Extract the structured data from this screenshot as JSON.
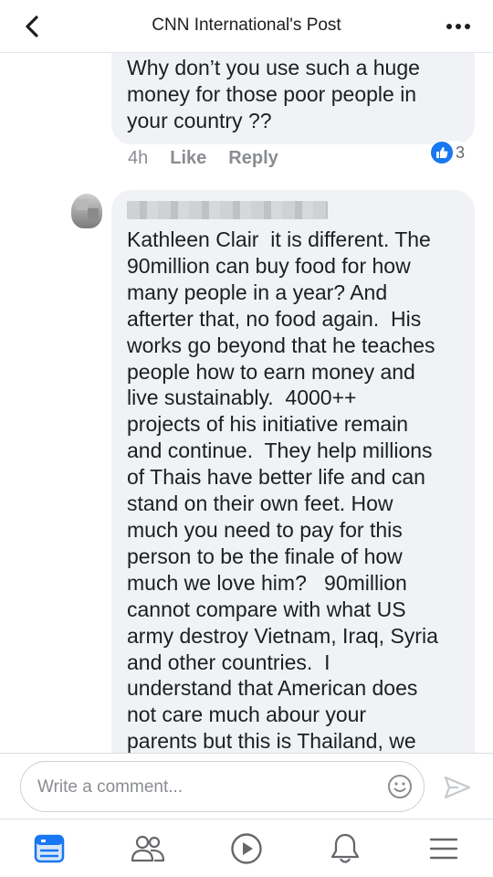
{
  "header": {
    "title": "CNN International's Post"
  },
  "comments": [
    {
      "text": "Why don’t you use such a huge\nmoney for those poor people in\nyour country ??",
      "time": "4h",
      "like_label": "Like",
      "reply_label": "Reply",
      "reaction_count": "3"
    },
    {
      "text": "Kathleen Clair  it is different. The\n90million can buy food for how\nmany people in a year? And\nafterter that, no food again.  His\nworks go beyond that he teaches\npeople how to earn money and\nlive sustainably.  4000++\nprojects of his initiative remain\nand continue.  They help millions\nof Thais have better life and can\nstand on their own feet. How\nmuch you need to pay for this\nperson to be the finale of how\nmuch we love him?   90million\ncannot compare with what US\narmy destroy Vietnam, Iraq, Syria\nand other countries.  I\nunderstand that American does\nnot care much abour your\nparents but this is Thailand, we"
    }
  ],
  "composer": {
    "placeholder": "Write a comment..."
  },
  "colors": {
    "accent": "#1877f2",
    "bubble": "#f0f2f5",
    "meta_text": "#8a8d91"
  },
  "icons": {
    "back": "chevron-left-icon",
    "more": "more-dots-icon",
    "like_reaction": "thumbs-up-icon",
    "emoji": "smiley-icon",
    "send": "send-icon",
    "nav": [
      "news-feed-icon",
      "friends-icon",
      "watch-icon",
      "notifications-icon",
      "menu-icon"
    ]
  }
}
